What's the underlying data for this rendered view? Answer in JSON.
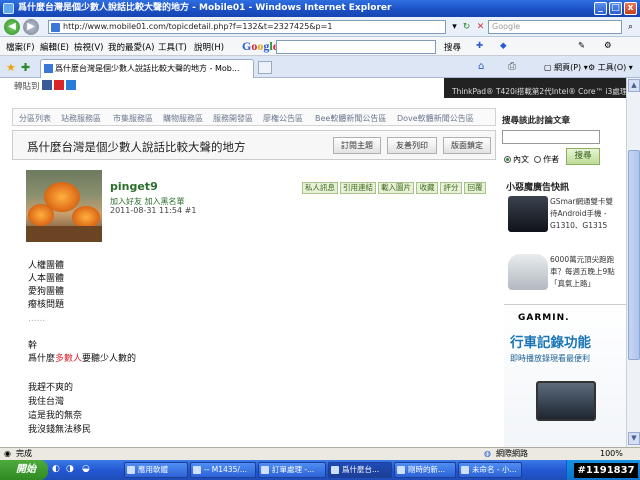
{
  "window": {
    "title": "爲什麼台灣是個少數人說話比較大聲的地方 - Mobile01 - Windows Internet Explorer",
    "min": "_",
    "max": "□",
    "close": "x"
  },
  "address": {
    "url": "http://www.mobile01.com/topicdetail.php?f=132&t=2327425&p=1",
    "search_placeholder": "Google"
  },
  "menu": {
    "items": [
      "檔案(F)",
      "編輯(E)",
      "檢視(V)",
      "我的最愛(A)",
      "工具(T)",
      "說明(H)"
    ],
    "google": "Google",
    "search": "搜尋",
    "tools": "工具(O)"
  },
  "tab": {
    "label": "爲什麼台灣是個少數人說話比較大聲的地方 - Mob..."
  },
  "page": {
    "share": "轉貼到",
    "banner": "ThinkPad® T420i搭載第2代Intel® Core™ i3處理器",
    "nav": [
      "分區列表",
      "站務服務區",
      "市集服務區",
      "購物服務區",
      "服務開發區",
      "廖権公告區",
      "Bee軟體新聞公告區",
      "Dove軟體新聞公告區"
    ],
    "title": "爲什麼台灣是個少數人說話比較大聲的地方",
    "buttons": [
      "訂閱主題",
      "友善列印",
      "版面鎖定"
    ],
    "post": {
      "username": "pinget9",
      "links": "加入好友  加入黑名單",
      "date": "2011-08-31 11:54  #1",
      "actions": [
        "私人訊息",
        "引用連結",
        "載入圖片",
        "收藏",
        "評分",
        "回覆"
      ]
    },
    "body": {
      "l1": "人權團體",
      "l2": "人本團體",
      "l3": "愛狗團體",
      "l4": "癈核問題",
      "dots": "......",
      "l5": "幹",
      "l6a": "爲什麼",
      "l6b": "多數人",
      "l6c": "要聽少人數的",
      "l7": "我趕不爽的",
      "l8": "我住台灣",
      "l9": "這是我的無奈",
      "l10": "我沒錢無法移民"
    },
    "sidebar": {
      "search_title": "搜尋該此討論文章",
      "radio1": "內文",
      "radio2": "作者",
      "search_btn": "搜尋",
      "ad_title": "小惡魔廣告快訊",
      "ad1": "GSmar網通雙卡雙待Android手機 - G1310、G1315",
      "ad2": "6000萬元頂尖跑跑車？每週五晚上9點「真氣上路」",
      "garmin_logo": "GARMIN.",
      "garmin_h": "行車記錄功能",
      "garmin_s": "即時播放錄現看最便利"
    }
  },
  "status": {
    "left": "完成",
    "zone": "網際網路",
    "zoom": "100%"
  },
  "taskbar": {
    "start": "開始",
    "items": [
      "應用軟體",
      "-- M1435/...",
      "訂單處理 -...",
      "爲什麼台...",
      "剛時的新...",
      "未命名 - 小..."
    ],
    "counter": "#1191837"
  },
  "colors": {
    "accent_green": "#2a6e2a",
    "highlight_red": "#d8262c",
    "garmin_blue": "#1876b8"
  }
}
